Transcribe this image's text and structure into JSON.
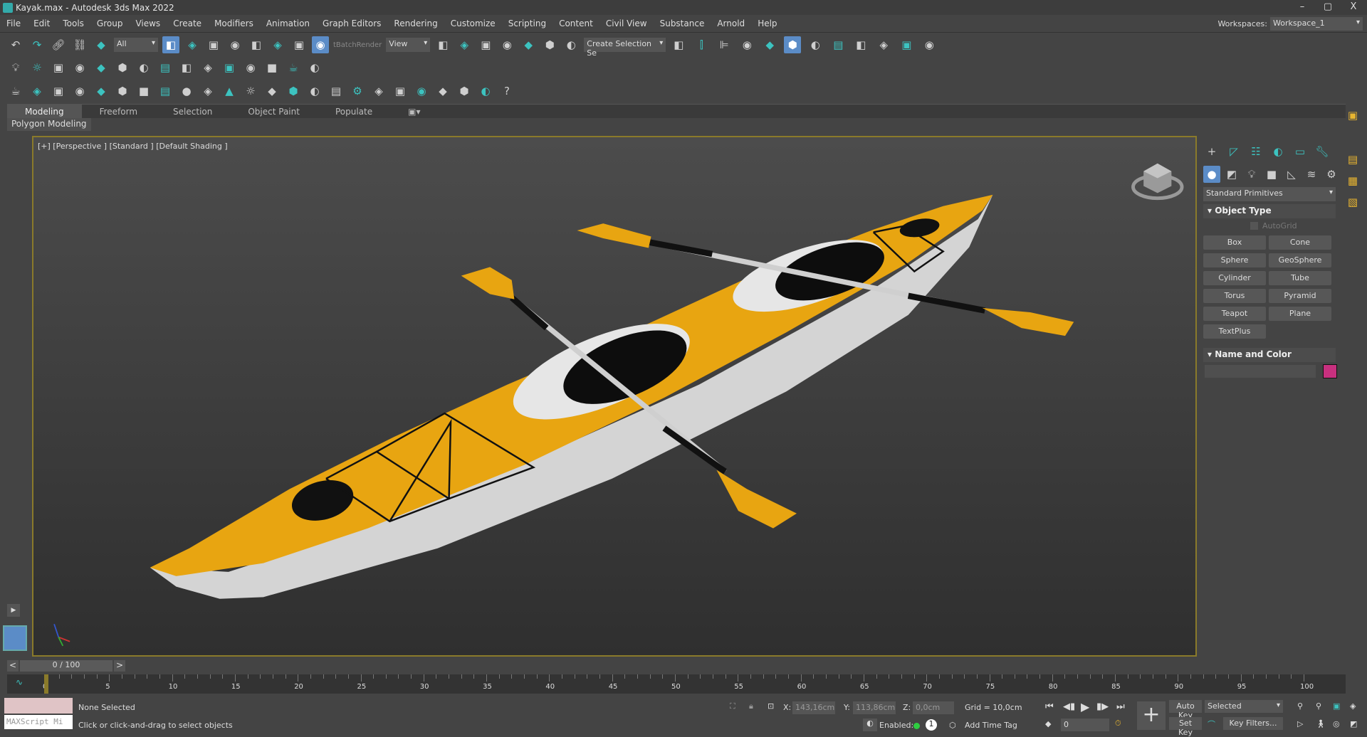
{
  "title": "Kayak.max - Autodesk 3ds Max 2022",
  "window_controls": {
    "minimize": "–",
    "maximize": "▢",
    "close": "X"
  },
  "menu": [
    "File",
    "Edit",
    "Tools",
    "Group",
    "Views",
    "Create",
    "Modifiers",
    "Animation",
    "Graph Editors",
    "Rendering",
    "Customize",
    "Scripting",
    "Content",
    "Civil View",
    "Substance",
    "Arnold",
    "Help"
  ],
  "workspaces": {
    "label": "Workspaces:",
    "value": "Workspace_1"
  },
  "toolbar1": {
    "filter": "All",
    "batch_render": "tBatchRender",
    "ref_coord": "View",
    "named_selection": "Create Selection Se",
    "icons": [
      "undo",
      "redo",
      "link",
      "unlink",
      "bind-space-warp"
    ],
    "icons2": [
      "select-object",
      "select-by-name",
      "rect-selection-region",
      "window-crossing"
    ],
    "icons3": [
      "select-move",
      "select-rotate",
      "select-scale",
      "select-place"
    ],
    "icons4": [
      "use-pivot-center",
      "select-manipulate",
      "keyboard-shortcut-override",
      "snaps-toggle",
      "angle-snap",
      "percent-snap",
      "spinner-snap"
    ],
    "icons5": [
      "edit-named-selections",
      "mirror",
      "align",
      "toggle-scene-explorer",
      "toggle-layer-explorer",
      "toggle-ribbon",
      "curve-editor",
      "schematic-view",
      "material-editor",
      "render-setup",
      "rendered-frame-window",
      "render-production"
    ]
  },
  "toolbar2_icons": [
    "light",
    "sun",
    "camera-target",
    "tree",
    "text",
    "pine",
    "lamp",
    "ring",
    "monitor",
    "frame",
    "window",
    "film",
    "box",
    "teapot",
    "bulb"
  ],
  "toolbar3_icons": [
    "teapot",
    "sky",
    "mat",
    "light-bulb",
    "gear-mat",
    "spider",
    "box",
    "dome",
    "sphere",
    "bowl",
    "cone",
    "sun",
    "egg",
    "checker",
    "capsule",
    "atom",
    "gear",
    "grass",
    "glass-sphere",
    "color-balls",
    "purple-node",
    "blue-red",
    "bottle",
    "help"
  ],
  "ribbon": {
    "tabs": [
      "Modeling",
      "Freeform",
      "Selection",
      "Object Paint",
      "Populate"
    ],
    "active": "Modeling",
    "panel": "Polygon Modeling"
  },
  "viewport": {
    "label": "[+] [Perspective ] [Standard ] [Default Shading ]"
  },
  "command_panel": {
    "category": "Standard Primitives",
    "object_type": "Object Type",
    "autogrid": "AutoGrid",
    "buttons": [
      "Box",
      "Cone",
      "Sphere",
      "GeoSphere",
      "Cylinder",
      "Tube",
      "Torus",
      "Pyramid",
      "Teapot",
      "Plane",
      "TextPlus"
    ],
    "name_and_color": "Name and Color",
    "name_value": "",
    "color": "#c8307f"
  },
  "colors": {
    "kayak_deck": "#e8a511",
    "kayak_hull": "#d8d8d8",
    "viewport_border": "#8a7a2a",
    "accent": "#5b8cc7"
  },
  "timeline": {
    "frame": "0 / 100",
    "prev": "<",
    "next": ">",
    "ticks": [
      0,
      5,
      10,
      15,
      20,
      25,
      30,
      35,
      40,
      45,
      50,
      55,
      60,
      65,
      70,
      75,
      80,
      85,
      90,
      95,
      100
    ]
  },
  "status": {
    "maxscript": "MAXScript Mi",
    "selection": "None Selected",
    "prompt": "Click or click-and-drag to select objects",
    "x_label": "X:",
    "x": "143,16cm",
    "y_label": "Y:",
    "y": "113,86cm",
    "z_label": "Z:",
    "z": "0,0cm",
    "grid": "Grid = 10,0cm",
    "enabled": "Enabled:",
    "add_time_tag": "Add Time Tag",
    "auto_key": "Auto Key",
    "set_key": "Set Key",
    "key_mode": "Selected",
    "key_filters": "Key Filters...",
    "frame_value": "0"
  }
}
